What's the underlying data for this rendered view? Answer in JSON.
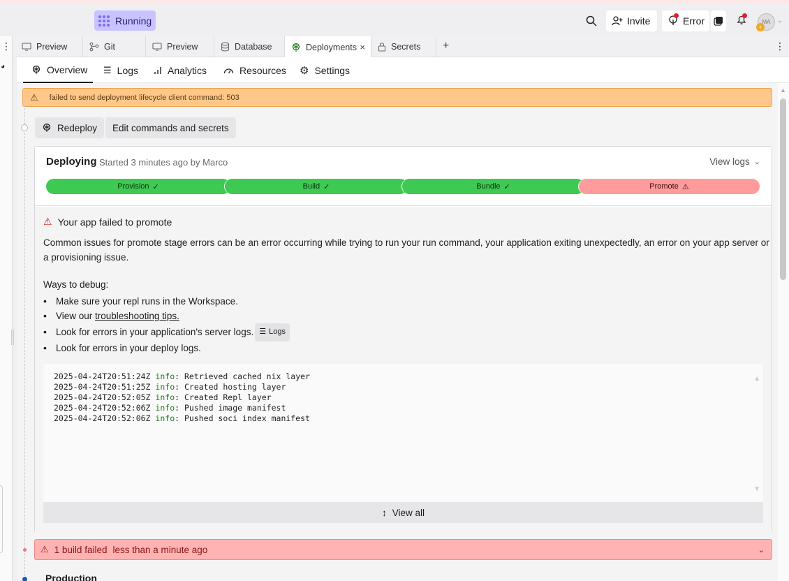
{
  "topbar": {
    "run_status": "Running",
    "invite_label": "Invite",
    "error_label": "Error",
    "avatar_initials": "MA"
  },
  "tabs": [
    {
      "label": "Preview",
      "icon": "monitor-icon"
    },
    {
      "label": "Git",
      "icon": "git-icon"
    },
    {
      "label": "Preview",
      "icon": "monitor-icon"
    },
    {
      "label": "Database",
      "icon": "database-icon"
    },
    {
      "label": "Deployments",
      "icon": "deploy-icon",
      "active": true
    },
    {
      "label": "Secrets",
      "icon": "lock-icon"
    }
  ],
  "subnav": [
    {
      "label": "Overview",
      "icon": "deploy-icon",
      "active": true
    },
    {
      "label": "Logs",
      "icon": "list-icon"
    },
    {
      "label": "Analytics",
      "icon": "bar-chart-icon"
    },
    {
      "label": "Resources",
      "icon": "gauge-icon"
    },
    {
      "label": "Settings",
      "icon": "gear-icon"
    }
  ],
  "banner": {
    "message": "failed to send deployment lifecycle client command: 503"
  },
  "actions": {
    "redeploy": "Redeploy",
    "edit": "Edit commands and secrets"
  },
  "deployment": {
    "status": "Deploying",
    "started": "Started 3 minutes ago by Marco",
    "view_logs": "View logs",
    "stages": [
      {
        "label": "Provision",
        "state": "done"
      },
      {
        "label": "Build",
        "state": "done"
      },
      {
        "label": "Bundle",
        "state": "done"
      },
      {
        "label": "Promote",
        "state": "failed"
      }
    ],
    "error_title": "Your app failed to promote",
    "error_desc": "Common issues for promote stage errors can be an error occurring while trying to run your run command, your application exiting unexpectedly, an error on your app server or a provisioning issue.",
    "ways_title": "Ways to debug:",
    "tip1": "Make sure your repl runs in the Workspace.",
    "tip2_prefix": "View our ",
    "tip2_link": "troubleshooting tips.",
    "tip3": "Look for errors in your application's server logs.",
    "tip3_chip": "Logs",
    "tip4": "Look for errors in your deploy logs.",
    "logs": [
      {
        "ts": "2025-04-24T20:51:24Z",
        "level": "info",
        "msg": ": Retrieved cached nix layer"
      },
      {
        "ts": "2025-04-24T20:51:25Z",
        "level": "info",
        "msg": ": Created hosting layer"
      },
      {
        "ts": "2025-04-24T20:52:05Z",
        "level": "info",
        "msg": ": Created Repl layer"
      },
      {
        "ts": "2025-04-24T20:52:06Z",
        "level": "info",
        "msg": ": Pushed image manifest"
      },
      {
        "ts": "2025-04-24T20:52:06Z",
        "level": "info",
        "msg": ": Pushed soci index manifest"
      }
    ],
    "view_all": "View all"
  },
  "build_failed": {
    "label": "1 build failed",
    "time": "less than a minute ago"
  },
  "production": {
    "title": "Production"
  },
  "colors": {
    "stage_done": "#3ec952",
    "stage_failed": "#ff9b9b",
    "banner": "#ffc88a",
    "running": "#c9c4ff"
  }
}
